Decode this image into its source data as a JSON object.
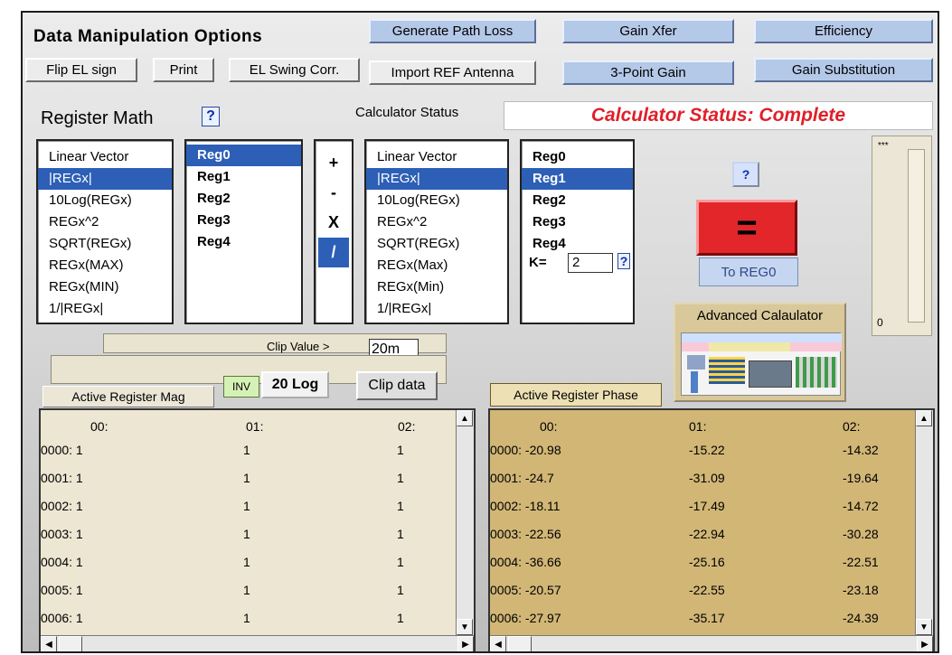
{
  "header": {
    "title": "Data Manipulation Options",
    "generate_path_loss": "Generate Path Loss",
    "gain_xfer": "Gain Xfer",
    "efficiency": "Efficiency",
    "flip_el_sign": "Flip EL sign",
    "print": "Print",
    "el_swing_corr": "EL Swing Corr.",
    "import_ref_antenna": "Import REF Antenna",
    "three_point_gain": "3-Point Gain",
    "gain_substitution": "Gain Substitution"
  },
  "register_math": {
    "label": "Register Math",
    "help": "?",
    "calc_status_label": "Calculator Status",
    "calc_status_value": "Calculator Status: Complete",
    "calc_status_color": "#e01f2a",
    "func_list_1": [
      "Linear Vector",
      "|REGx|",
      "10Log(REGx)",
      "REGx^2",
      "SQRT(REGx)",
      "REGx(MAX)",
      "REGx(MIN)",
      "1/|REGx|"
    ],
    "func_list_1_selected": 1,
    "reg_list_1": [
      "Reg0",
      "Reg1",
      "Reg2",
      "Reg3",
      "Reg4"
    ],
    "reg_list_1_selected": 0,
    "operators": [
      "+",
      "-",
      "X",
      "/"
    ],
    "operators_selected": 3,
    "func_list_2": [
      "Linear Vector",
      "|REGx|",
      "10Log(REGx)",
      "REGx^2",
      "SQRT(REGx)",
      "REGx(Max)",
      "REGx(Min)",
      "1/|REGx|"
    ],
    "func_list_2_selected": 1,
    "reg_list_2": [
      "Reg0",
      "Reg1",
      "Reg2",
      "Reg3",
      "Reg4"
    ],
    "reg_list_2_selected": 1,
    "k_label": "K=",
    "k_value": "2",
    "k_help": "?",
    "equals_help": "?",
    "equals_label": "=",
    "equals_color": "#e2262a",
    "to_reg_label": "To REG0",
    "advanced_label": "Advanced Calaulator",
    "meter_top": "***",
    "meter_bottom": "0"
  },
  "clip": {
    "label": "Clip Value >",
    "value": "20m",
    "inv_label": "INV",
    "log_label": "20 Log",
    "clip_button": "Clip data"
  },
  "mag_table": {
    "tab_label": "Active Register  Mag",
    "headers": [
      "00:",
      "01:",
      "02:"
    ],
    "rows": [
      [
        "0000: 1",
        "1",
        "1"
      ],
      [
        "0001: 1",
        "1",
        "1"
      ],
      [
        "0002: 1",
        "1",
        "1"
      ],
      [
        "0003: 1",
        "1",
        "1"
      ],
      [
        "0004: 1",
        "1",
        "1"
      ],
      [
        "0005: 1",
        "1",
        "1"
      ],
      [
        "0006: 1",
        "1",
        "1"
      ]
    ]
  },
  "phase_table": {
    "tab_label": "Active Register Phase",
    "headers": [
      "00:",
      "01:",
      "02:"
    ],
    "rows": [
      [
        "0000: -20.98",
        "-15.22",
        "-14.32"
      ],
      [
        "0001: -24.7",
        "-31.09",
        "-19.64"
      ],
      [
        "0002: -18.11",
        "-17.49",
        "-14.72"
      ],
      [
        "0003: -22.56",
        "-22.94",
        "-30.28"
      ],
      [
        "0004: -36.66",
        "-25.16",
        "-22.51"
      ],
      [
        "0005: -20.57",
        "-22.55",
        "-23.18"
      ],
      [
        "0006: -27.97",
        "-35.17",
        "-24.39"
      ]
    ]
  },
  "scroll_icons": {
    "up": "up-arrow-icon",
    "down": "down-arrow-icon",
    "left": "left-arrow-icon",
    "right": "right-arrow-icon"
  }
}
